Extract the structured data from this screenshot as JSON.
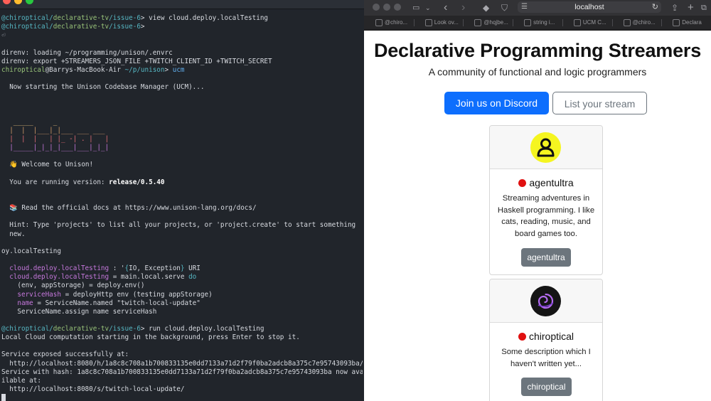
{
  "terminal": {
    "lines": [
      [
        {
          "t": "@chiroptical/",
          "c": "c-cyan"
        },
        {
          "t": "declarative-tv",
          "c": "c-green"
        },
        {
          "t": "/issue-6",
          "c": "c-cyan"
        },
        {
          "t": "> view cloud.deploy.localTesting"
        }
      ],
      [
        {
          "t": "@chiroptical/",
          "c": "c-cyan"
        },
        {
          "t": "declarative-tv",
          "c": "c-green"
        },
        {
          "t": "/issue-6",
          "c": "c-cyan"
        },
        {
          "t": ">"
        }
      ],
      [
        {
          "t": "⏎",
          "c": "c-dim"
        }
      ],
      [
        {
          "t": ""
        }
      ],
      [
        {
          "t": "direnv: loading ~/programming/unison/.envrc"
        }
      ],
      [
        {
          "t": "direnv: export +STREAMERS_JSON_FILE +TWITCH_CLIENT_ID +TWITCH_SECRET"
        }
      ],
      [
        {
          "t": "chiroptical",
          "c": "c-green"
        },
        {
          "t": "@Barrys-MacBook-Air "
        },
        {
          "t": "~/p/unison",
          "c": "c-cyan"
        },
        {
          "t": "> "
        },
        {
          "t": "ucm",
          "c": "c-blue"
        }
      ],
      [
        {
          "t": ""
        }
      ],
      [
        {
          "t": "  Now starting the Unison Codebase Manager (UCM)..."
        }
      ],
      [
        {
          "t": ""
        }
      ],
      [
        {
          "t": ""
        }
      ],
      [
        {
          "t": ""
        }
      ],
      [
        {
          "t": "   _____     _             ",
          "c": "c-yellow"
        }
      ],
      [
        {
          "t": "  |  |  |___|_|___ ___ ___ ",
          "c": "c-orange"
        }
      ],
      [
        {
          "t": "  |  |  |   | |_ -| . |   |",
          "c": "c-red"
        }
      ],
      [
        {
          "t": "  |_____|_|_|_|___|___|_|_|",
          "c": "c-mag"
        }
      ],
      [
        {
          "t": ""
        }
      ],
      [
        {
          "t": "  👋 Welcome to Unison!"
        }
      ],
      [
        {
          "t": ""
        }
      ],
      [
        {
          "t": "  You are running version: "
        },
        {
          "t": "release/0.5.40",
          "c": "c-bold"
        }
      ],
      [
        {
          "t": ""
        }
      ],
      [
        {
          "t": ""
        }
      ],
      [
        {
          "t": "  📚 Read the official docs at https://www.unison-lang.org/docs/"
        }
      ],
      [
        {
          "t": ""
        }
      ],
      [
        {
          "t": "  Hint: Type 'projects' to list all your projects, or 'project.create' to start something"
        }
      ],
      [
        {
          "t": "  new."
        }
      ],
      [
        {
          "t": ""
        }
      ],
      [
        {
          "t": "oy.localTesting"
        }
      ],
      [
        {
          "t": ""
        }
      ],
      [
        {
          "t": "  cloud.deploy.localTesting",
          "c": "c-mag"
        },
        {
          "t": " : '"
        },
        {
          "t": "{",
          "c": "c-cyan"
        },
        {
          "t": "IO, Exception"
        },
        {
          "t": "}",
          "c": "c-cyan"
        },
        {
          "t": " URI"
        }
      ],
      [
        {
          "t": "  cloud.deploy.localTesting",
          "c": "c-mag"
        },
        {
          "t": " = main.local.serve "
        },
        {
          "t": "do",
          "c": "c-cyan"
        }
      ],
      [
        {
          "t": "    (env, appStorage) = deploy.env()"
        }
      ],
      [
        {
          "t": "    serviceHash",
          "c": "c-mag"
        },
        {
          "t": " = deployHttp env (testing appStorage)"
        }
      ],
      [
        {
          "t": "    name",
          "c": "c-mag"
        },
        {
          "t": " = ServiceName.named \"twitch-local-update\""
        }
      ],
      [
        {
          "t": "    ServiceName.assign name serviceHash"
        }
      ],
      [
        {
          "t": ""
        }
      ],
      [
        {
          "t": "@chiroptical/",
          "c": "c-cyan"
        },
        {
          "t": "declarative-tv",
          "c": "c-green"
        },
        {
          "t": "/issue-6",
          "c": "c-cyan"
        },
        {
          "t": "> run cloud.deploy.localTesting"
        }
      ],
      [
        {
          "t": "Local Cloud computation starting in the background, press Enter to stop it."
        }
      ],
      [
        {
          "t": ""
        }
      ],
      [
        {
          "t": "Service exposed successfully at:"
        }
      ],
      [
        {
          "t": "  http://localhost:8080/h/1a8c8c708a1b700833135e0dd7133a71d2f79f0ba2adcb8a375c7e95743093ba/"
        }
      ],
      [
        {
          "t": "Service with hash: 1a8c8c708a1b700833135e0dd7133a71d2f79f0ba2adcb8a375c7e95743093ba now ava"
        }
      ],
      [
        {
          "t": "ilable at:"
        }
      ],
      [
        {
          "t": "  http://localhost:8080/s/twitch-local-update/"
        }
      ]
    ]
  },
  "browser": {
    "address": "localhost",
    "tabs": [
      "@chiro...",
      "Look ov...",
      "@hqjbe...",
      "string i...",
      "UCM C...",
      "@chiro...",
      "Declara"
    ],
    "page": {
      "title": "Declarative Programming Streamers",
      "subtitle": "A community of functional and logic programmers",
      "discord_label": "Join us on Discord",
      "list_label": "List your stream",
      "cards": [
        {
          "name": "agentultra",
          "desc": "Streaming adventures in Haskell programming. I like cats, reading, music, and board games too.",
          "button": "agentultra",
          "avatar": "person-avatar-icon"
        },
        {
          "name": "chiroptical",
          "desc": "Some description which I haven't written yet...",
          "button": "chiroptical",
          "avatar": "spiral-logo-avatar"
        }
      ]
    }
  },
  "colors": {
    "accent": "#0d6efd",
    "secondary": "#6c757d",
    "live": "#e01010",
    "avatar_yellow": "#f5f520",
    "terminal_bg": "#21252b"
  }
}
